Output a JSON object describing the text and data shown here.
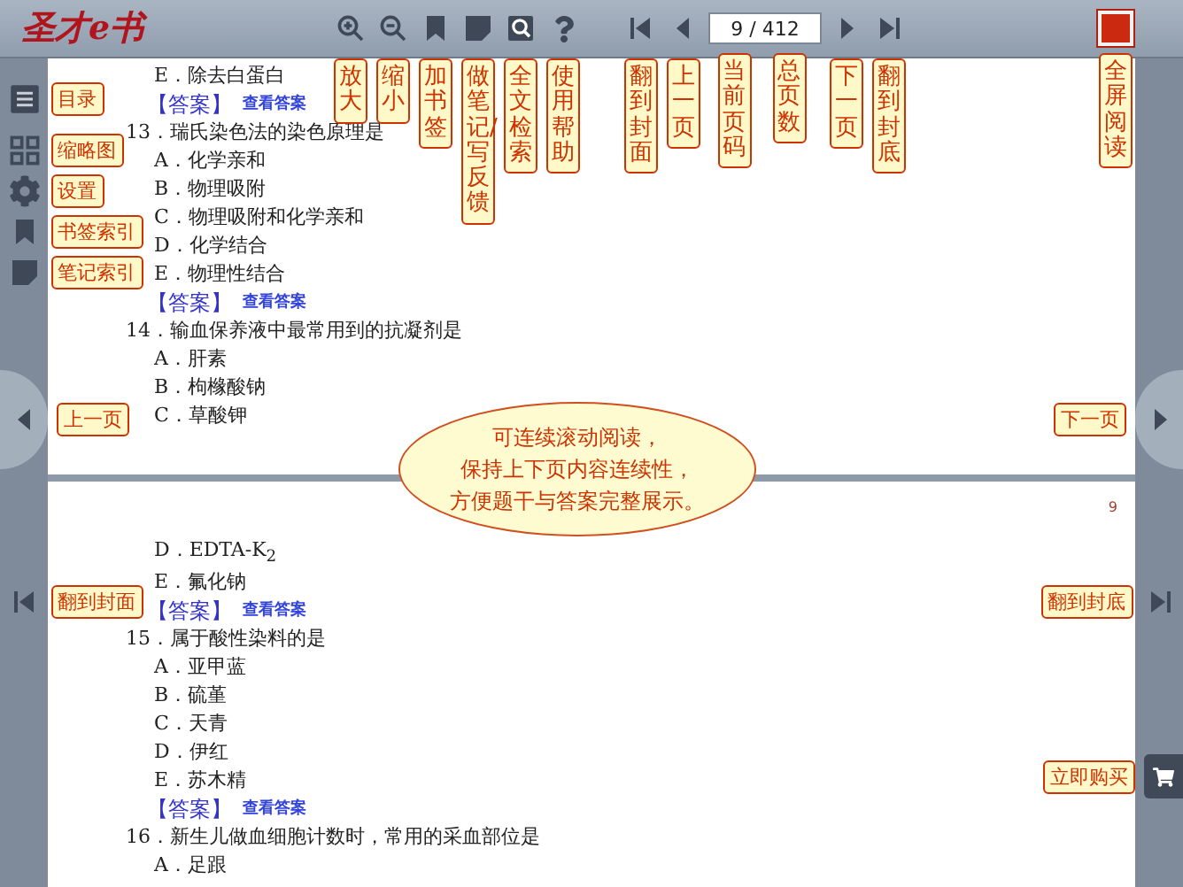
{
  "toolbar": {
    "logo": "圣才e书",
    "tools": [
      {
        "kind": "zoom-in",
        "tip": "放大"
      },
      {
        "kind": "zoom-out",
        "tip": "缩小"
      },
      {
        "kind": "bookmark",
        "tip": "加书签"
      },
      {
        "kind": "note",
        "tip": "做笔记/写反馈"
      },
      {
        "kind": "search",
        "tip": "全文检索"
      },
      {
        "kind": "help",
        "tip": "使用帮助"
      }
    ],
    "pager": [
      {
        "kind": "first",
        "tip": "翻到封面"
      },
      {
        "kind": "prev",
        "tip": "上一页"
      },
      {
        "kind": "field",
        "value": "9 / 412",
        "tips": [
          "当前页码",
          "总页数"
        ]
      },
      {
        "kind": "next",
        "tip": "下一页"
      },
      {
        "kind": "last",
        "tip": "翻到封底"
      }
    ],
    "fullscreen": {
      "tip": "全屏阅读"
    }
  },
  "left_rail": {
    "tools": [
      {
        "kind": "toc",
        "tip": "目录"
      },
      {
        "kind": "thumbnails",
        "tip": "缩略图"
      },
      {
        "kind": "settings",
        "tip": "设置"
      },
      {
        "kind": "bookmark",
        "tip": "书签索引"
      },
      {
        "kind": "note",
        "tip": "笔记索引"
      }
    ],
    "prev_page": {
      "tip": "上一页"
    },
    "first_page": {
      "tip": "翻到封面"
    }
  },
  "right_rail": {
    "next_page": {
      "tip": "下一页"
    },
    "last_page": {
      "tip": "翻到封底"
    },
    "buy": {
      "tip": "立即购买"
    }
  },
  "pages": [
    {
      "lines": [
        {
          "kind": "option",
          "text": "E．除去白蛋白"
        },
        {
          "kind": "answer",
          "label": "【答案】",
          "link": "查看答案"
        },
        {
          "kind": "question",
          "text": "13．瑞氏染色法的染色原理是"
        },
        {
          "kind": "option",
          "text": "A．化学亲和"
        },
        {
          "kind": "option",
          "text": "B．物理吸附"
        },
        {
          "kind": "option",
          "text": "C．物理吸附和化学亲和"
        },
        {
          "kind": "option",
          "text": "D．化学结合"
        },
        {
          "kind": "option",
          "text": "E．物理性结合"
        },
        {
          "kind": "answer",
          "label": "【答案】",
          "link": "查看答案"
        },
        {
          "kind": "question",
          "text": "14．输血保养液中最常用到的抗凝剂是"
        },
        {
          "kind": "option",
          "text": "A．肝素"
        },
        {
          "kind": "option",
          "text": "B．枸橼酸钠"
        },
        {
          "kind": "option",
          "text": "C．草酸钾"
        }
      ]
    },
    {
      "page_number": "9",
      "lines": [
        {
          "kind": "option",
          "text": "D．EDTA-K$_{2}$"
        },
        {
          "kind": "option",
          "text": "E．氟化钠"
        },
        {
          "kind": "answer",
          "label": "【答案】",
          "link": "查看答案"
        },
        {
          "kind": "question",
          "text": "15．属于酸性染料的是"
        },
        {
          "kind": "option",
          "text": "A．亚甲蓝"
        },
        {
          "kind": "option",
          "text": "B．硫堇"
        },
        {
          "kind": "option",
          "text": "C．天青"
        },
        {
          "kind": "option",
          "text": "D．伊红"
        },
        {
          "kind": "option",
          "text": "E．苏木精"
        },
        {
          "kind": "answer",
          "label": "【答案】",
          "link": "查看答案"
        },
        {
          "kind": "question",
          "text": "16．新生儿做血细胞计数时，常用的采血部位是"
        },
        {
          "kind": "option",
          "text": "A．足跟"
        }
      ]
    }
  ],
  "notice": {
    "lines": [
      "可连续滚动阅读，",
      "保持上下页内容连续性，",
      "方便题干与答案完整展示。"
    ]
  }
}
